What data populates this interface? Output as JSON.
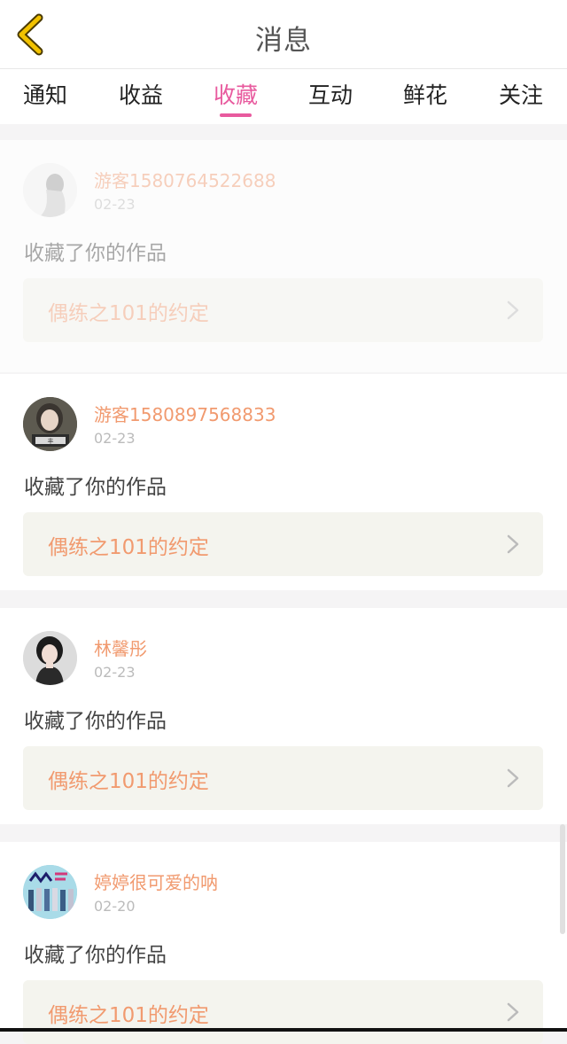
{
  "header": {
    "title": "消息",
    "back_icon": "chevron-left-icon",
    "accent": "#f2c200"
  },
  "tabs": [
    {
      "label": "通知",
      "active": false
    },
    {
      "label": "收益",
      "active": false
    },
    {
      "label": "收藏",
      "active": true
    },
    {
      "label": "互动",
      "active": false
    },
    {
      "label": "鲜花",
      "active": false
    },
    {
      "label": "关注",
      "active": false
    }
  ],
  "colors": {
    "tab_active": "#e85a9e",
    "username": "#f19a6f",
    "work_title": "#f19a6f",
    "work_box_bg": "#f4f4ee"
  },
  "notifications": [
    {
      "username": "游客1580764522688",
      "date": "02-23",
      "action": "收藏了你的作品",
      "work": "偶练之101的约定",
      "avatar": "avatar-default-icon"
    },
    {
      "username": "游客1580897568833",
      "date": "02-23",
      "action": "收藏了你的作品",
      "work": "偶练之101的约定",
      "avatar": "avatar-girl-icon"
    },
    {
      "username": "林馨彤",
      "date": "02-23",
      "action": "收藏了你的作品",
      "work": "偶练之101的约定",
      "avatar": "avatar-woman-icon"
    },
    {
      "username": "婷婷很可爱的呐",
      "date": "02-20",
      "action": "收藏了你的作品",
      "work": "偶练之101的约定",
      "avatar": "avatar-group-icon"
    }
  ]
}
